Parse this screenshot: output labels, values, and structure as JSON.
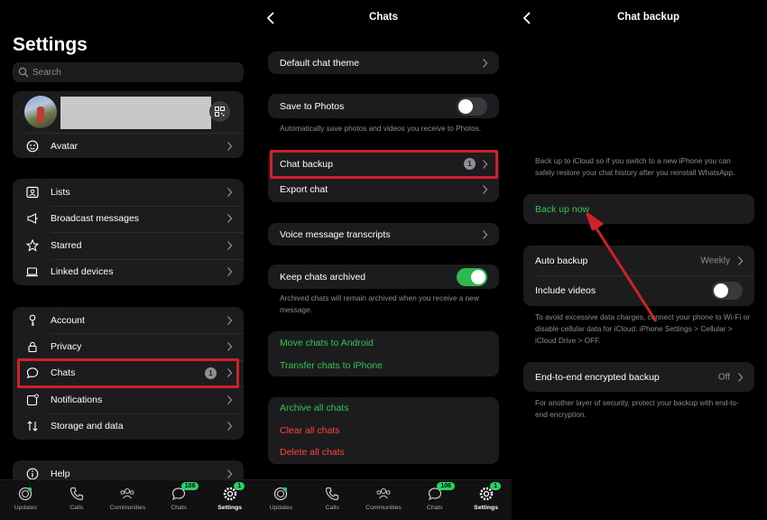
{
  "settings": {
    "title": "Settings",
    "search_placeholder": "Search",
    "profile_item": "Avatar",
    "group1": [
      "Lists",
      "Broadcast messages",
      "Starred",
      "Linked devices"
    ],
    "group2": [
      "Account",
      "Privacy",
      "Chats",
      "Notifications",
      "Storage and data"
    ],
    "chats_badge": "1",
    "help": "Help"
  },
  "chats": {
    "title": "Chats",
    "default_theme": "Default chat theme",
    "save_to_photos": "Save to Photos",
    "save_note": "Automatically save photos and videos you receive to Photos.",
    "chat_backup": "Chat backup",
    "backup_badge": "1",
    "export_chat": "Export chat",
    "voice_transcripts": "Voice message transcripts",
    "keep_archived": "Keep chats archived",
    "archived_note": "Archived chats will remain archived when you receive a new message.",
    "move_android": "Move chats to Android",
    "transfer_iphone": "Transfer chats to iPhone",
    "archive_all": "Archive all chats",
    "clear_all": "Clear all chats",
    "delete_all": "Delete all chats"
  },
  "backup": {
    "title": "Chat backup",
    "intro": "Back up to iCloud so if you switch to a new iPhone you can safely restore your chat history after you reinstall WhatsApp.",
    "back_up_now": "Back up now",
    "auto_backup": "Auto backup",
    "auto_backup_value": "Weekly",
    "include_videos": "Include videos",
    "data_note": "To avoid excessive data charges, connect your phone to Wi-Fi or disable cellular data for iCloud: iPhone Settings > Cellular > iCloud Drive > OFF.",
    "e2e": "End-to-end encrypted backup",
    "e2e_value": "Off",
    "e2e_note": "For another layer of security, protect your backup with end-to-end encryption."
  },
  "tabbar": {
    "updates": "Updates",
    "calls": "Calls",
    "communities": "Communities",
    "chats": "Chats",
    "settings": "Settings",
    "chats_count": "106",
    "settings_count": "1"
  },
  "colors": {
    "accent_green": "#2fc657",
    "highlight_red": "#d0202a",
    "destructive": "#ff453a"
  }
}
